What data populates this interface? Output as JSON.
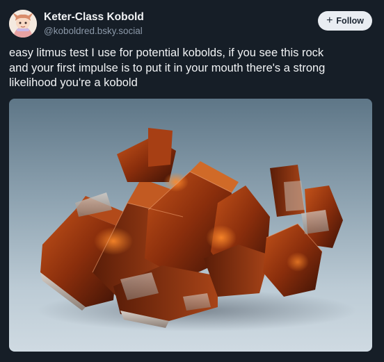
{
  "post": {
    "author": {
      "display_name": "Keter-Class Kobold",
      "handle": "@koboldred.bsky.social",
      "avatar_icon": "avatar-illustration"
    },
    "follow_button": {
      "icon": "plus-icon",
      "label": "Follow"
    },
    "text_lines": [
      "easy litmus test I use for potential kobolds, if you see this rock",
      "and your first impulse is to put it in your mouth there's a strong",
      "likelihood you're a kobold"
    ],
    "image": {
      "subject": "mineral-crystal-photo"
    }
  },
  "colors": {
    "background": "#161e27",
    "text": "#f1f3f5",
    "secondary_text": "#8b98a8",
    "follow_bg": "#e9edf2",
    "crystal": "#8a2e0c"
  }
}
